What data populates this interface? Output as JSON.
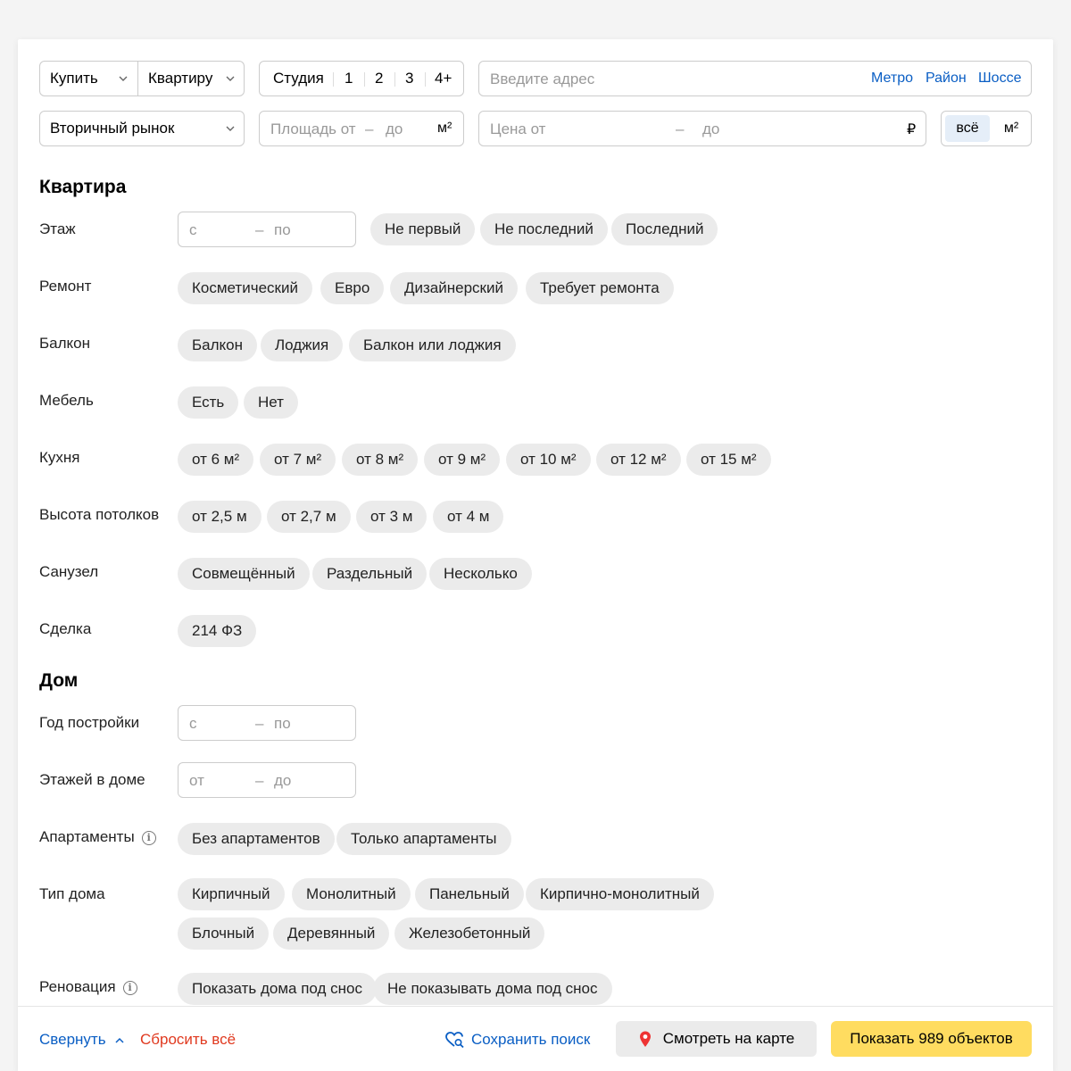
{
  "top": {
    "deal_type": "Купить",
    "property_type": "Квартиру",
    "rooms": [
      "Студия",
      "1",
      "2",
      "3",
      "4+"
    ],
    "address_placeholder": "Введите адрес",
    "address_links": [
      "Метро",
      "Район",
      "Шоссе"
    ],
    "market": "Вторичный рынок",
    "area_from_placeholder": "Площадь от",
    "dash": "–",
    "area_to_placeholder": "до",
    "area_unit": "м²",
    "price_from_placeholder": "Цена от",
    "price_to_placeholder": "до",
    "price_unit": "₽",
    "price_mode": [
      "всё",
      "м²"
    ]
  },
  "section_apartment": {
    "title": "Квартира",
    "floor": {
      "label": "Этаж",
      "from": "с",
      "to": "по",
      "chips": [
        "Не первый",
        "Не последний",
        "Последний"
      ]
    },
    "repair": {
      "label": "Ремонт",
      "chips": [
        "Косметический",
        "Евро",
        "Дизайнерский",
        "Требует ремонта"
      ]
    },
    "balcony": {
      "label": "Балкон",
      "chips": [
        "Балкон",
        "Лоджия",
        "Балкон или лоджия"
      ]
    },
    "furniture": {
      "label": "Мебель",
      "chips": [
        "Есть",
        "Нет"
      ]
    },
    "kitchen": {
      "label": "Кухня",
      "chips": [
        "от 6 м²",
        "от 7 м²",
        "от 8 м²",
        "от 9 м²",
        "от 10 м²",
        "от 12 м²",
        "от 15 м²"
      ]
    },
    "ceiling": {
      "label": "Высота потолков",
      "chips": [
        "от 2,5 м",
        "от 2,7 м",
        "от 3 м",
        "от 4 м"
      ]
    },
    "bathroom": {
      "label": "Санузел",
      "chips": [
        "Совмещённый",
        "Раздельный",
        "Несколько"
      ]
    },
    "deal": {
      "label": "Сделка",
      "chips": [
        "214 ФЗ"
      ]
    }
  },
  "section_house": {
    "title": "Дом",
    "year": {
      "label": "Год постройки",
      "from": "с",
      "to": "по"
    },
    "floors": {
      "label": "Этажей в доме",
      "from": "от",
      "to": "до"
    },
    "apartments": {
      "label": "Апартаменты",
      "chips": [
        "Без апартаментов",
        "Только апартаменты"
      ]
    },
    "house_type": {
      "label": "Тип дома",
      "chips": [
        "Кирпичный",
        "Монолитный",
        "Панельный",
        "Кирпично-монолитный",
        "Блочный",
        "Деревянный",
        "Железобетонный"
      ]
    },
    "renovation": {
      "label": "Реновация",
      "chips": [
        "Показать дома под снос",
        "Не показывать дома под снос"
      ]
    }
  },
  "footer": {
    "collapse": "Свернуть",
    "reset": "Сбросить всё",
    "save_search": "Сохранить поиск",
    "show_map": "Смотреть на карте",
    "show_results": "Показать 989 объектов"
  },
  "colors": {
    "accent_blue": "#0a5ec4",
    "reset_red": "#e0391f",
    "primary_yellow": "#ffdc60",
    "chip_gray": "#ebebeb",
    "selected_blue": "#e5eef8",
    "map_pin_red": "#ee3333"
  },
  "icons": [
    "chevron-down-icon",
    "chevron-up-icon",
    "info-icon",
    "heart-search-icon",
    "map-pin-icon"
  ]
}
